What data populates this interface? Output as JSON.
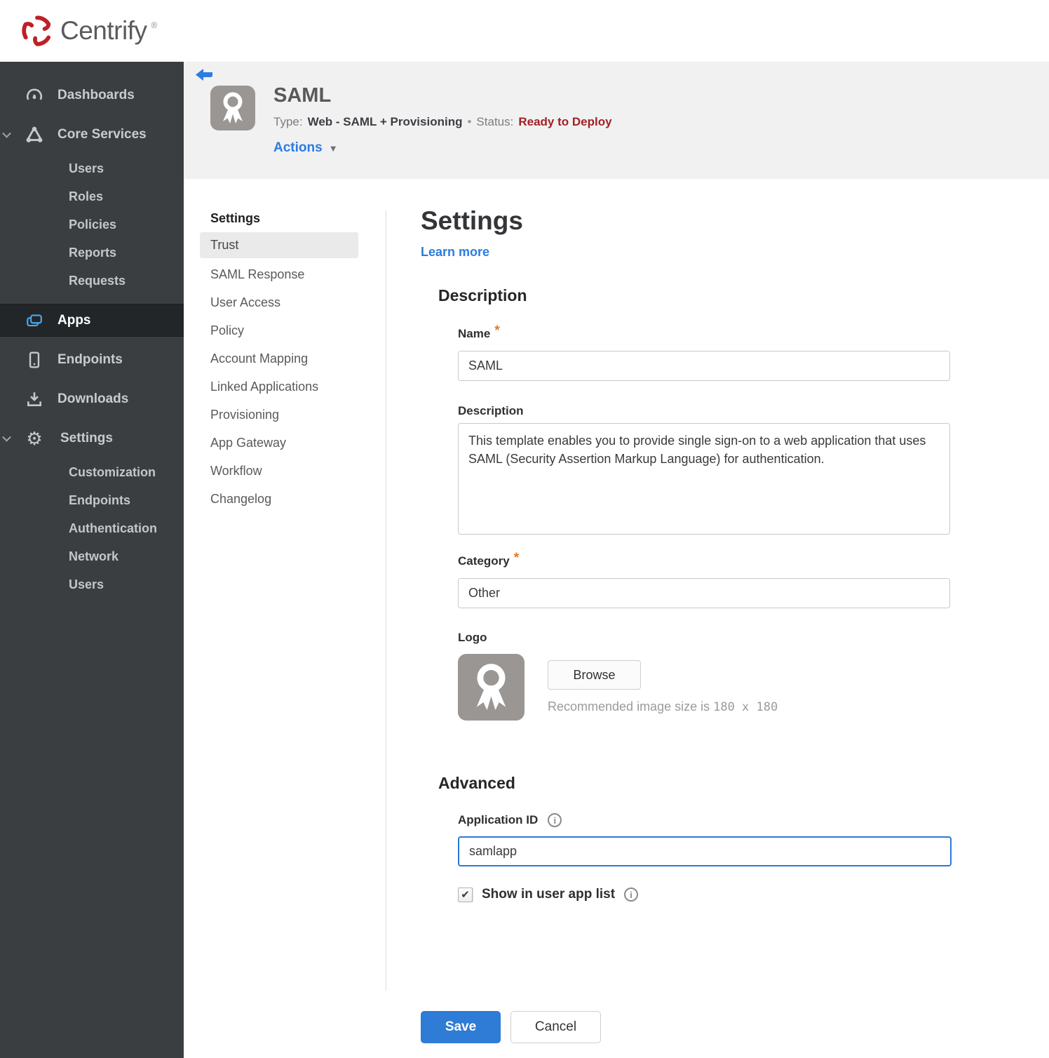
{
  "brand": {
    "name": "Centrify",
    "trademark": "®"
  },
  "sidebar": {
    "dashboards": "Dashboards",
    "core_services": "Core Services",
    "core_children": [
      "Users",
      "Roles",
      "Policies",
      "Reports",
      "Requests"
    ],
    "apps": "Apps",
    "endpoints": "Endpoints",
    "downloads": "Downloads",
    "settings": "Settings",
    "settings_children": [
      "Customization",
      "Endpoints",
      "Authentication",
      "Network",
      "Users"
    ]
  },
  "header": {
    "app_name": "SAML",
    "type_label": "Type:",
    "type_value": "Web - SAML + Provisioning",
    "separator": "•",
    "status_label": "Status:",
    "status_value": "Ready to Deploy",
    "actions_label": "Actions",
    "caret": "▼"
  },
  "subnav": {
    "title": "Settings",
    "items": [
      "Trust",
      "SAML Response",
      "User Access",
      "Policy",
      "Account Mapping",
      "Linked Applications",
      "Provisioning",
      "App Gateway",
      "Workflow",
      "Changelog"
    ],
    "active_item": "Trust"
  },
  "main": {
    "title": "Settings",
    "learn_more": "Learn more",
    "required_marker": "*",
    "description_section": "Description",
    "name_label": "Name",
    "name_value": "SAML",
    "description_label": "Description",
    "description_value": "This template enables you to provide single sign-on to a web application that uses SAML (Security Assertion Markup Language) for authentication.",
    "category_label": "Category",
    "category_value": "Other",
    "logo_label": "Logo",
    "browse_label": "Browse",
    "logo_hint_prefix": "Recommended image size is ",
    "logo_hint_size": "180 x 180",
    "advanced_section": "Advanced",
    "app_id_label": "Application ID",
    "app_id_value": "samlapp",
    "show_in_app_list_label": "Show in user app list",
    "info_glyph": "i",
    "check_glyph": "✔"
  },
  "footer": {
    "save_label": "Save",
    "cancel_label": "Cancel"
  },
  "colors": {
    "accent_blue": "#2b7ce0",
    "save_blue": "#2e7cd6",
    "status_red": "#a41f24",
    "required_orange": "#e87722",
    "sidebar_bg": "#3b3e41",
    "sidebar_active_bg": "#232628",
    "apps_icon_blue": "#4aa9e9",
    "header_band": "#f1f1f1",
    "brand_red": "#bf2026"
  }
}
